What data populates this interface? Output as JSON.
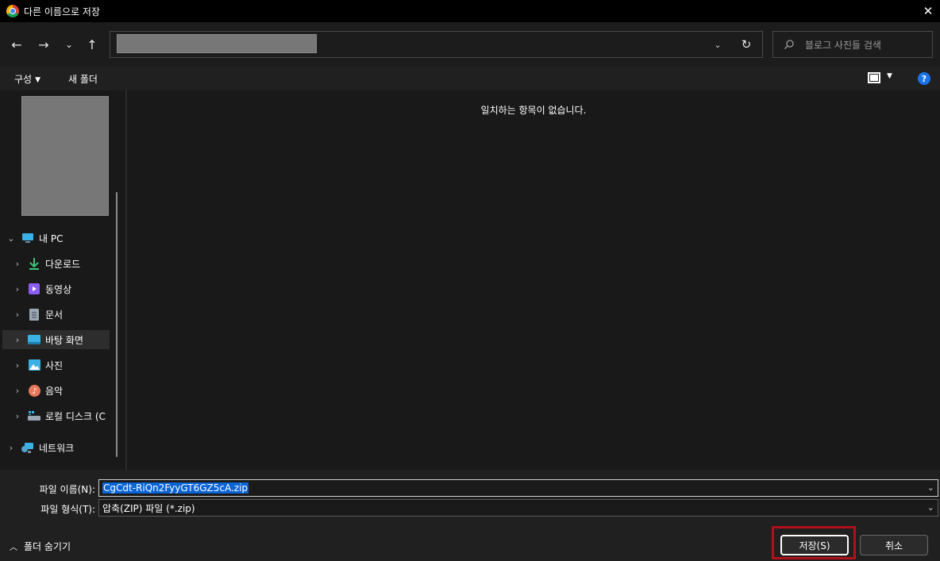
{
  "window": {
    "title": "다른 이름으로 저장"
  },
  "nav": {
    "back_icon": "←",
    "forward_icon": "→",
    "recent_icon": "⌄",
    "up_icon": "↑",
    "address_dropdown_icon": "⌄",
    "refresh_icon": "↻",
    "search_placeholder": "블로그 사진들 검색"
  },
  "command_bar": {
    "organize_label": "구성",
    "new_folder_label": "새 폴더"
  },
  "sidebar": {
    "items": [
      {
        "label": "내 PC",
        "icon": "pc-icon"
      },
      {
        "label": "다운로드",
        "icon": "download-icon"
      },
      {
        "label": "동영상",
        "icon": "video-icon"
      },
      {
        "label": "문서",
        "icon": "document-icon"
      },
      {
        "label": "바탕 화면",
        "icon": "desktop-icon"
      },
      {
        "label": "사진",
        "icon": "pictures-icon"
      },
      {
        "label": "음악",
        "icon": "music-icon"
      },
      {
        "label": "로컬 디스크 (C",
        "icon": "drive-icon"
      },
      {
        "label": "네트워크",
        "icon": "network-icon"
      }
    ]
  },
  "main": {
    "empty_message": "일치하는 항목이 없습니다."
  },
  "form": {
    "filename_label": "파일 이름(N):",
    "filename_value": "CgCdt-RiQn2FyyGT6GZ5cA.zip",
    "filetype_label": "파일 형식(T):",
    "filetype_value": "압축(ZIP) 파일 (*.zip)",
    "hide_folders_label": "폴더 숨기기",
    "save_label": "저장(S)",
    "cancel_label": "취소"
  },
  "colors": {
    "accent_selection": "#0a64d6",
    "highlight_box": "#b0101a",
    "help_icon": "#1a73e8"
  }
}
